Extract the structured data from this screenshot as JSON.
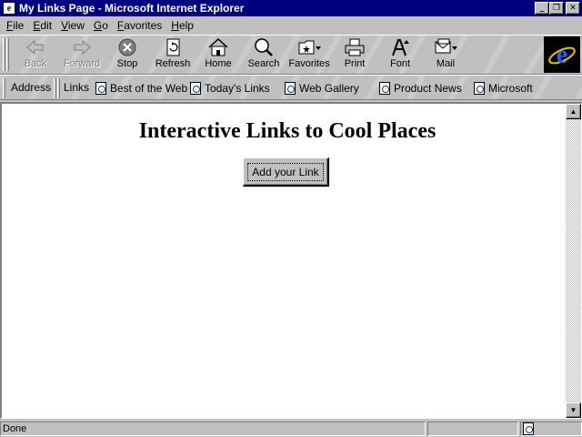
{
  "window": {
    "title": "My Links Page - Microsoft Internet Explorer",
    "controls": {
      "minimize": "_",
      "maximize": "❐",
      "close": "✕"
    }
  },
  "menu": [
    {
      "label": "File",
      "key": "F",
      "rest": "ile"
    },
    {
      "label": "Edit",
      "key": "E",
      "rest": "dit"
    },
    {
      "label": "View",
      "key": "V",
      "rest": "iew"
    },
    {
      "label": "Go",
      "key": "G",
      "rest": "o"
    },
    {
      "label": "Favorites",
      "key": "F",
      "rest": "avorites",
      "prefix": "",
      "split": "Fa"
    },
    {
      "label": "Help",
      "key": "H",
      "rest": "elp"
    }
  ],
  "toolbar": {
    "back": "Back",
    "forward": "Forward",
    "stop": "Stop",
    "refresh": "Refresh",
    "home": "Home",
    "search": "Search",
    "favorites": "Favorites",
    "print": "Print",
    "font": "Font",
    "mail": "Mail"
  },
  "linkbar": {
    "address": "Address",
    "links": "Links",
    "items": [
      "Best of the Web",
      "Today's Links",
      "Web Gallery",
      "Product News",
      "Microsoft"
    ]
  },
  "page": {
    "heading": "Interactive Links to Cool Places",
    "add_button": "Add your Link"
  },
  "status": {
    "text": "Done"
  },
  "colors": {
    "titlebar": "#000080",
    "chrome": "#c0c0c0",
    "page": "#ffffff"
  }
}
